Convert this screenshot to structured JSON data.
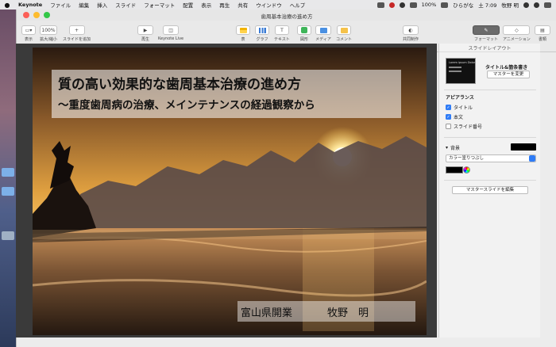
{
  "menubar": {
    "app_name": "Keynote",
    "menus": [
      "ファイル",
      "編集",
      "挿入",
      "スライド",
      "フォーマット",
      "配置",
      "表示",
      "再生",
      "共有",
      "ウインドウ",
      "ヘルプ"
    ],
    "battery": "100%",
    "input_mode": "ひらがな",
    "clock": "土 7:09",
    "user": "牧野 明"
  },
  "window": {
    "doc_title": "歯周基本治療の進め方"
  },
  "toolbar": {
    "view": "表示",
    "zoom_value": "100%",
    "zoom": "拡大/縮小",
    "add_slide": "スライドを追加",
    "play": "再生",
    "keynote_live": "Keynote Live",
    "table": "表",
    "chart": "グラフ",
    "text": "テキスト",
    "shape": "図形",
    "media": "メディア",
    "comment": "コメント",
    "collaborate": "共同制作",
    "format": "フォーマット",
    "animate": "アニメーション",
    "document": "書類"
  },
  "slide": {
    "title_line1": "質の高い効果的な歯周基本治療の進め方",
    "title_line2": "〜重度歯周病の治療、メインテナンスの経過観察から",
    "org": "富山県開業",
    "name": "牧野　明"
  },
  "inspector": {
    "tab_label": "スライドレイアウト",
    "layout_thumb_text": "Lorem ipsum Dolor",
    "layout_name": "タイトル&箇条書き",
    "change_master": "マスターを変更",
    "appearance": "アピアランス",
    "check_title": "タイトル",
    "check_body": "本文",
    "check_slide_number": "スライド番号",
    "background": "背景",
    "fill_option": "カラー塗りつぶし",
    "edit_master": "マスタースライドを編集",
    "accent_color": "#2f7cf6"
  }
}
